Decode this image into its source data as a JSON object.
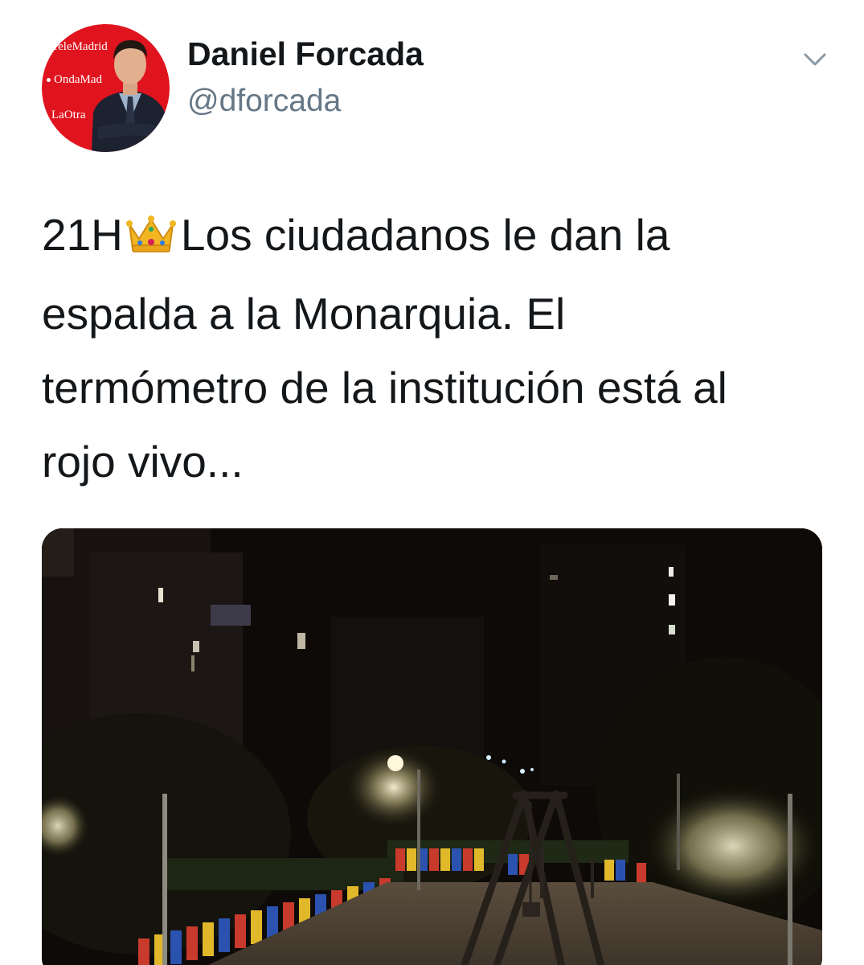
{
  "author": {
    "name": "Daniel Forcada",
    "handle": "@dforcada",
    "avatar_brands": [
      "TeleMadrid",
      "OndaMad",
      "LaOtra"
    ]
  },
  "tweet": {
    "lead": "21H",
    "emoji": "crown-emoji",
    "lines": [
      "Los ciudadanos le dan la",
      "espalda a la Monarquia. El",
      "termómetro de la institución está al",
      "rojo vivo..."
    ]
  },
  "media": {
    "type": "video",
    "description_icon": "playground-night-scene"
  },
  "colors": {
    "text": "#14171a",
    "secondary": "#657786",
    "avatar_bg": "#e0141e"
  }
}
